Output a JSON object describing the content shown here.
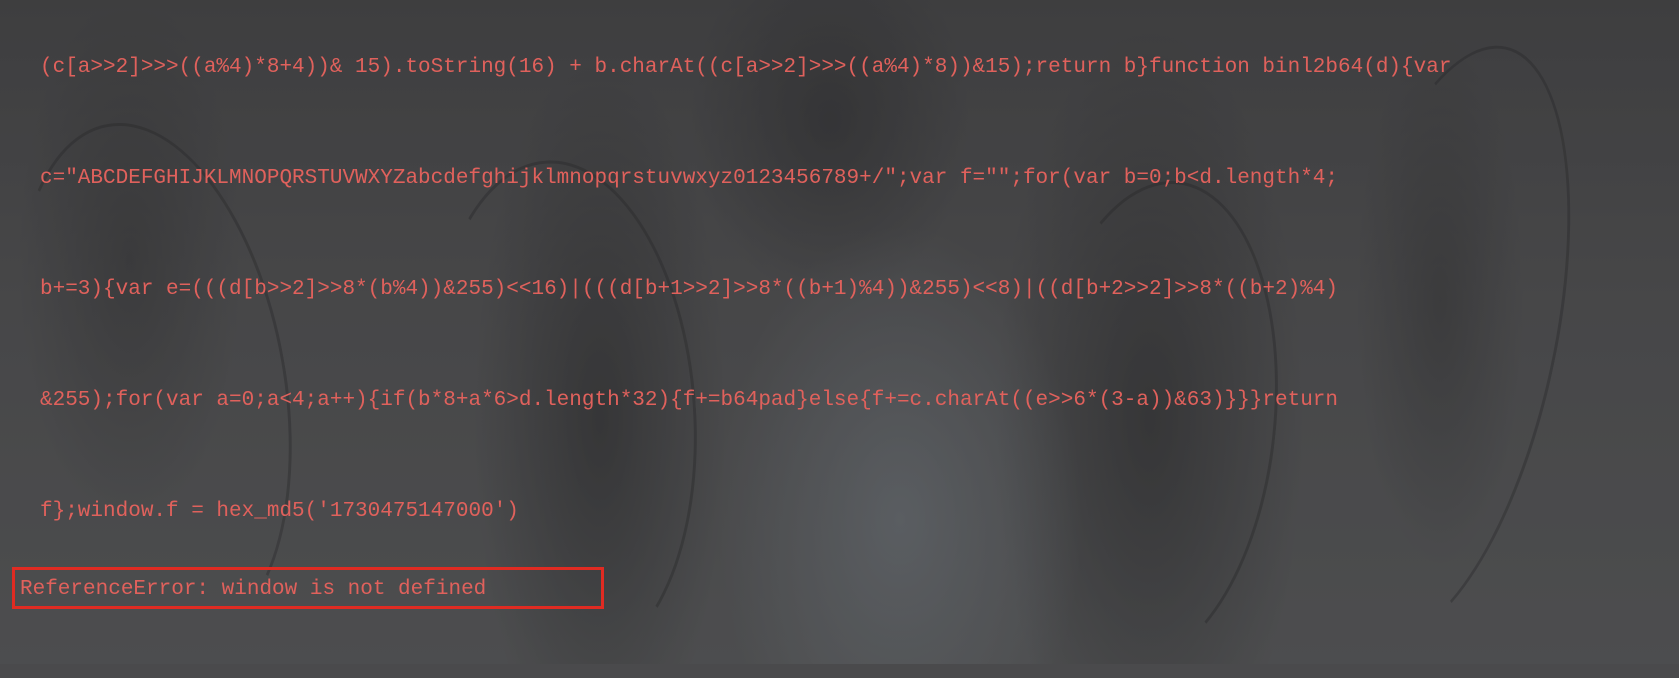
{
  "console": {
    "lines": [
      "(c[a>>2]>>>((a%4)*8+4))& 15).toString(16) + b.charAt((c[a>>2]>>>((a%4)*8))&15);return b}function binl2b64(d){var",
      "c=\"ABCDEFGHIJKLMNOPQRSTUVWXYZabcdefghijklmnopqrstuvwxyz0123456789+/\";var f=\"\";for(var b=0;b<d.length*4;",
      "b+=3){var e=(((d[b>>2]>>8*(b%4))&255)<<16)|(((d[b+1>>2]>>8*((b+1)%4))&255)<<8)|((d[b+2>>2]>>8*((b+2)%4)",
      "&255);for(var a=0;a<4;a++){if(b*8+a*6>d.length*32){f+=b64pad}else{f+=c.charAt((e>>6*(3-a))&63)}}}return",
      "f};window.f = hex_md5('1730475147000')"
    ],
    "error_message": "ReferenceError: window is not defined"
  },
  "colors": {
    "console_text": "#e0615c",
    "highlight_box": "#e02b22"
  }
}
